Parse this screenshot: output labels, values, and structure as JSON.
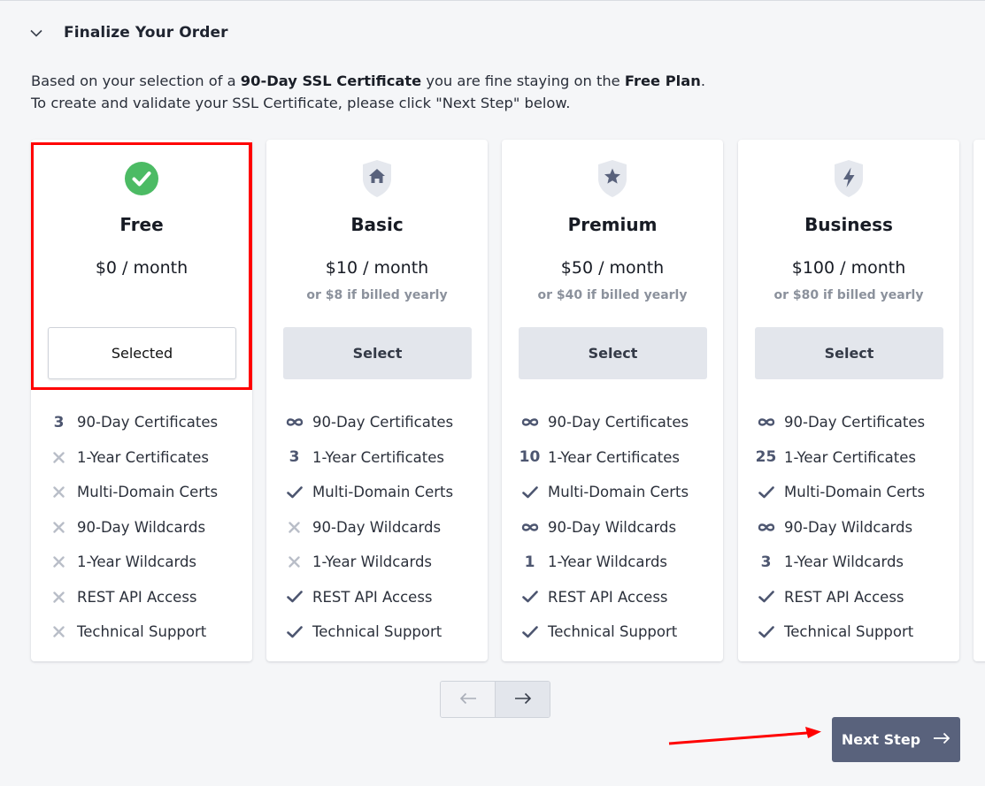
{
  "section": {
    "title": "Finalize Your Order",
    "intro_pre": "Based on your selection of a ",
    "intro_bold_1": "90-Day SSL Certificate",
    "intro_mid": " you are fine staying on the ",
    "intro_bold_2": "Free Plan",
    "intro_end": ".",
    "intro_line2": "To create and validate your SSL Certificate, please click \"Next Step\" below."
  },
  "plans": [
    {
      "name": "Free",
      "price": "$0 / month",
      "yearly": "",
      "button": "Selected",
      "icon": "check-circle-icon",
      "features": [
        {
          "icon": "3",
          "label": "90-Day Certificates"
        },
        {
          "icon": "cross",
          "label": "1-Year Certificates"
        },
        {
          "icon": "cross",
          "label": "Multi-Domain Certs"
        },
        {
          "icon": "cross",
          "label": "90-Day Wildcards"
        },
        {
          "icon": "cross",
          "label": "1-Year Wildcards"
        },
        {
          "icon": "cross",
          "label": "REST API Access"
        },
        {
          "icon": "cross",
          "label": "Technical Support"
        }
      ]
    },
    {
      "name": "Basic",
      "price": "$10 / month",
      "yearly": "or $8 if billed yearly",
      "button": "Select",
      "icon": "home-shield-icon",
      "features": [
        {
          "icon": "infinity",
          "label": "90-Day Certificates"
        },
        {
          "icon": "3",
          "label": "1-Year Certificates"
        },
        {
          "icon": "check",
          "label": "Multi-Domain Certs"
        },
        {
          "icon": "cross",
          "label": "90-Day Wildcards"
        },
        {
          "icon": "cross",
          "label": "1-Year Wildcards"
        },
        {
          "icon": "check",
          "label": "REST API Access"
        },
        {
          "icon": "check",
          "label": "Technical Support"
        }
      ]
    },
    {
      "name": "Premium",
      "price": "$50 / month",
      "yearly": "or $40 if billed yearly",
      "button": "Select",
      "icon": "star-shield-icon",
      "features": [
        {
          "icon": "infinity",
          "label": "90-Day Certificates"
        },
        {
          "icon": "10",
          "label": "1-Year Certificates"
        },
        {
          "icon": "check",
          "label": "Multi-Domain Certs"
        },
        {
          "icon": "infinity",
          "label": "90-Day Wildcards"
        },
        {
          "icon": "1",
          "label": "1-Year Wildcards"
        },
        {
          "icon": "check",
          "label": "REST API Access"
        },
        {
          "icon": "check",
          "label": "Technical Support"
        }
      ]
    },
    {
      "name": "Business",
      "price": "$100 / month",
      "yearly": "or $80 if billed yearly",
      "button": "Select",
      "icon": "bolt-shield-icon",
      "features": [
        {
          "icon": "infinity",
          "label": "90-Day Certificates"
        },
        {
          "icon": "25",
          "label": "1-Year Certificates"
        },
        {
          "icon": "check",
          "label": "Multi-Domain Certs"
        },
        {
          "icon": "infinity",
          "label": "90-Day Wildcards"
        },
        {
          "icon": "3",
          "label": "1-Year Wildcards"
        },
        {
          "icon": "check",
          "label": "REST API Access"
        },
        {
          "icon": "check",
          "label": "Technical Support"
        }
      ]
    }
  ],
  "pagination": {
    "prev_icon": "arrow-left-icon",
    "next_icon": "arrow-right-icon"
  },
  "actions": {
    "next_step": "Next Step",
    "next_step_icon": "arrow-right-icon"
  },
  "colors": {
    "accent": "#59627c",
    "check_green": "#4cbb64",
    "highlight_red": "#ff0000",
    "feature_icon": "#4d5670",
    "disabled_icon": "#b9bec8"
  }
}
